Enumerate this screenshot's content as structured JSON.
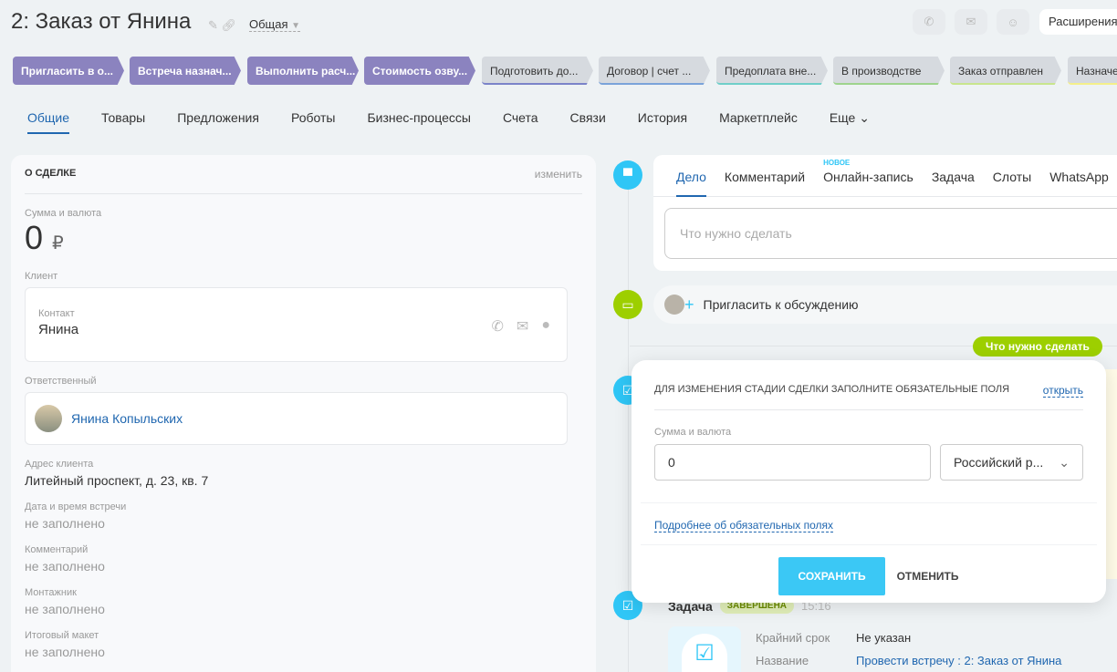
{
  "header": {
    "title": "2: Заказ от Янина",
    "category": "Общая",
    "extensions": "Расширения"
  },
  "stages": [
    {
      "label": "Пригласить в о...",
      "done": true
    },
    {
      "label": "Встреча назнач...",
      "done": true
    },
    {
      "label": "Выполнить расч...",
      "done": true
    },
    {
      "label": "Стоимость озву...",
      "done": true
    },
    {
      "label": "Подготовить до...",
      "done": false,
      "color": "#7b83c9"
    },
    {
      "label": "Договор | счет ...",
      "done": false,
      "color": "#7aa3da"
    },
    {
      "label": "Предоплата вне...",
      "done": false,
      "color": "#6fcfc9"
    },
    {
      "label": "В производстве",
      "done": false,
      "color": "#9ed48d"
    },
    {
      "label": "Заказ отправлен",
      "done": false,
      "color": "#c8e58d"
    },
    {
      "label": "Назначе...",
      "done": false,
      "color": "#f4ef8a"
    }
  ],
  "tabs": [
    "Общие",
    "Товары",
    "Предложения",
    "Роботы",
    "Бизнес-процессы",
    "Счета",
    "Связи",
    "История",
    "Маркетплейс",
    "Еще"
  ],
  "deal": {
    "heading": "О СДЕЛКЕ",
    "edit": "изменить",
    "sum_label": "Сумма и валюта",
    "sum": "0",
    "currency": "₽",
    "client_label": "Клиент",
    "contact_label": "Контакт",
    "contact": "Янина",
    "responsible_label": "Ответственный",
    "responsible": "Янина Копыльских",
    "fields": [
      {
        "label": "Адрес клиента",
        "value": "Литейный проспект, д. 23, кв. 7",
        "empty": false
      },
      {
        "label": "Дата и время встречи",
        "value": "не заполнено",
        "empty": true
      },
      {
        "label": "Комментарий",
        "value": "не заполнено",
        "empty": true
      },
      {
        "label": "Монтажник",
        "value": "не заполнено",
        "empty": true
      },
      {
        "label": "Итоговый макет",
        "value": "не заполнено",
        "empty": true
      }
    ]
  },
  "activity": {
    "tabs": [
      "Дело",
      "Комментарий",
      "Онлайн-запись",
      "Задача",
      "Слоты",
      "WhatsApp"
    ],
    "new_badge": "НОВОЕ",
    "placeholder": "Что нужно сделать",
    "invite": "Пригласить к обсуждению",
    "pill": "Что нужно сделать"
  },
  "task": {
    "title": "Задача",
    "status": "ЗАВЕРШЕНА",
    "time": "15:16",
    "deadline_label": "Крайний срок",
    "deadline": "Не указан",
    "name_label": "Название",
    "name": "Провести встречу : 2: Заказ от Янина"
  },
  "popup": {
    "heading": "ДЛЯ ИЗМЕНЕНИЯ СТАДИИ СДЕЛКИ ЗАПОЛНИТЕ ОБЯЗАТЕЛЬНЫЕ ПОЛЯ",
    "open": "открыть",
    "sum_label": "Сумма и валюта",
    "sum_value": "0",
    "currency": "Российский р...",
    "more": "Подробнее об обязательных полях",
    "save": "СОХРАНИТЬ",
    "cancel": "ОТМЕНИТЬ"
  }
}
